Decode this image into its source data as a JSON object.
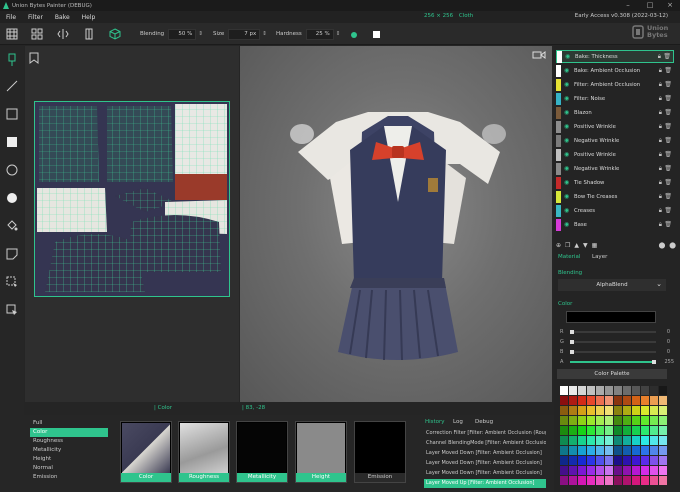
{
  "window": {
    "title": "Union Bytes Painter (DEBUG)",
    "resolution": "256 × 256",
    "object": "Cloth",
    "version": "Early Access v0.308 (2022-03-12)"
  },
  "menu": [
    "File",
    "Filter",
    "Bake",
    "Help"
  ],
  "toolbar": {
    "blending_label": "Blending",
    "blending_value": "50 %",
    "size_label": "Size",
    "size_value": "7 px",
    "hardness_label": "Hardness",
    "hardness_value": "25 %"
  },
  "logo": {
    "line1": "Union",
    "line2": "Bytes"
  },
  "status": {
    "mode": "| Color",
    "coords": "| 83, -28"
  },
  "layers": [
    {
      "name": "Bake: Thickness",
      "color": "#ffffff",
      "selected": true
    },
    {
      "name": "Bake: Ambient Occlusion",
      "color": "#ffffff"
    },
    {
      "name": "Filter: Ambient Occlusion",
      "color": "#e6e234"
    },
    {
      "name": "Filter: Noise",
      "color": "#36b3c6"
    },
    {
      "name": "Blazon",
      "color": "#7a5a3a"
    },
    {
      "name": "Positive Wrinkle",
      "color": "#8d8d8d"
    },
    {
      "name": "Negative Wrinkle",
      "color": "#7b7b7b"
    },
    {
      "name": "Positive Wrinkle",
      "color": "#bfbfbf"
    },
    {
      "name": "Negative Wrinkle",
      "color": "#8a8a8a"
    },
    {
      "name": "Tie Shadow",
      "color": "#c42a2a"
    },
    {
      "name": "Bow Tie Creases",
      "color": "#d8e83a"
    },
    {
      "name": "Creases",
      "color": "#3ab8c4"
    },
    {
      "name": "Base",
      "color": "#d63ad8"
    }
  ],
  "material_tabs": {
    "material": "Material",
    "layer": "Layer"
  },
  "blending": {
    "label": "Blending",
    "mode": "AlphaBlend"
  },
  "color": {
    "label": "Color",
    "r_label": "R",
    "g_label": "G",
    "b_label": "B",
    "a_label": "A",
    "r": "0",
    "g": "0",
    "b": "0",
    "a": "255",
    "palette_button": "Color Palette"
  },
  "channels": [
    "Full",
    "Color",
    "Roughness",
    "Metallicity",
    "Height",
    "Normal",
    "Emission"
  ],
  "selected_channel": "Color",
  "thumbs": [
    {
      "label": "Color",
      "active": true
    },
    {
      "label": "Roughness",
      "active": true
    },
    {
      "label": "Metallicity",
      "active": true
    },
    {
      "label": "Height",
      "active": true
    },
    {
      "label": "Emission",
      "active": false
    }
  ],
  "history_tabs": {
    "history": "History",
    "log": "Log",
    "debug": "Debug"
  },
  "history": [
    "Correction Filter [Filter: Ambient Occlusion (Rough",
    "Channel BlendingMode [Filter: Ambient Occlusion]",
    "Layer Moved Down [Filter: Ambient Occlusion]",
    "Layer Moved Down [Filter: Ambient Occlusion]",
    "Layer Moved Down [Filter: Ambient Occlusion]",
    "Layer Moved Up [Filter: Ambient Occlusion]"
  ],
  "accent_color": "#2fc48d"
}
